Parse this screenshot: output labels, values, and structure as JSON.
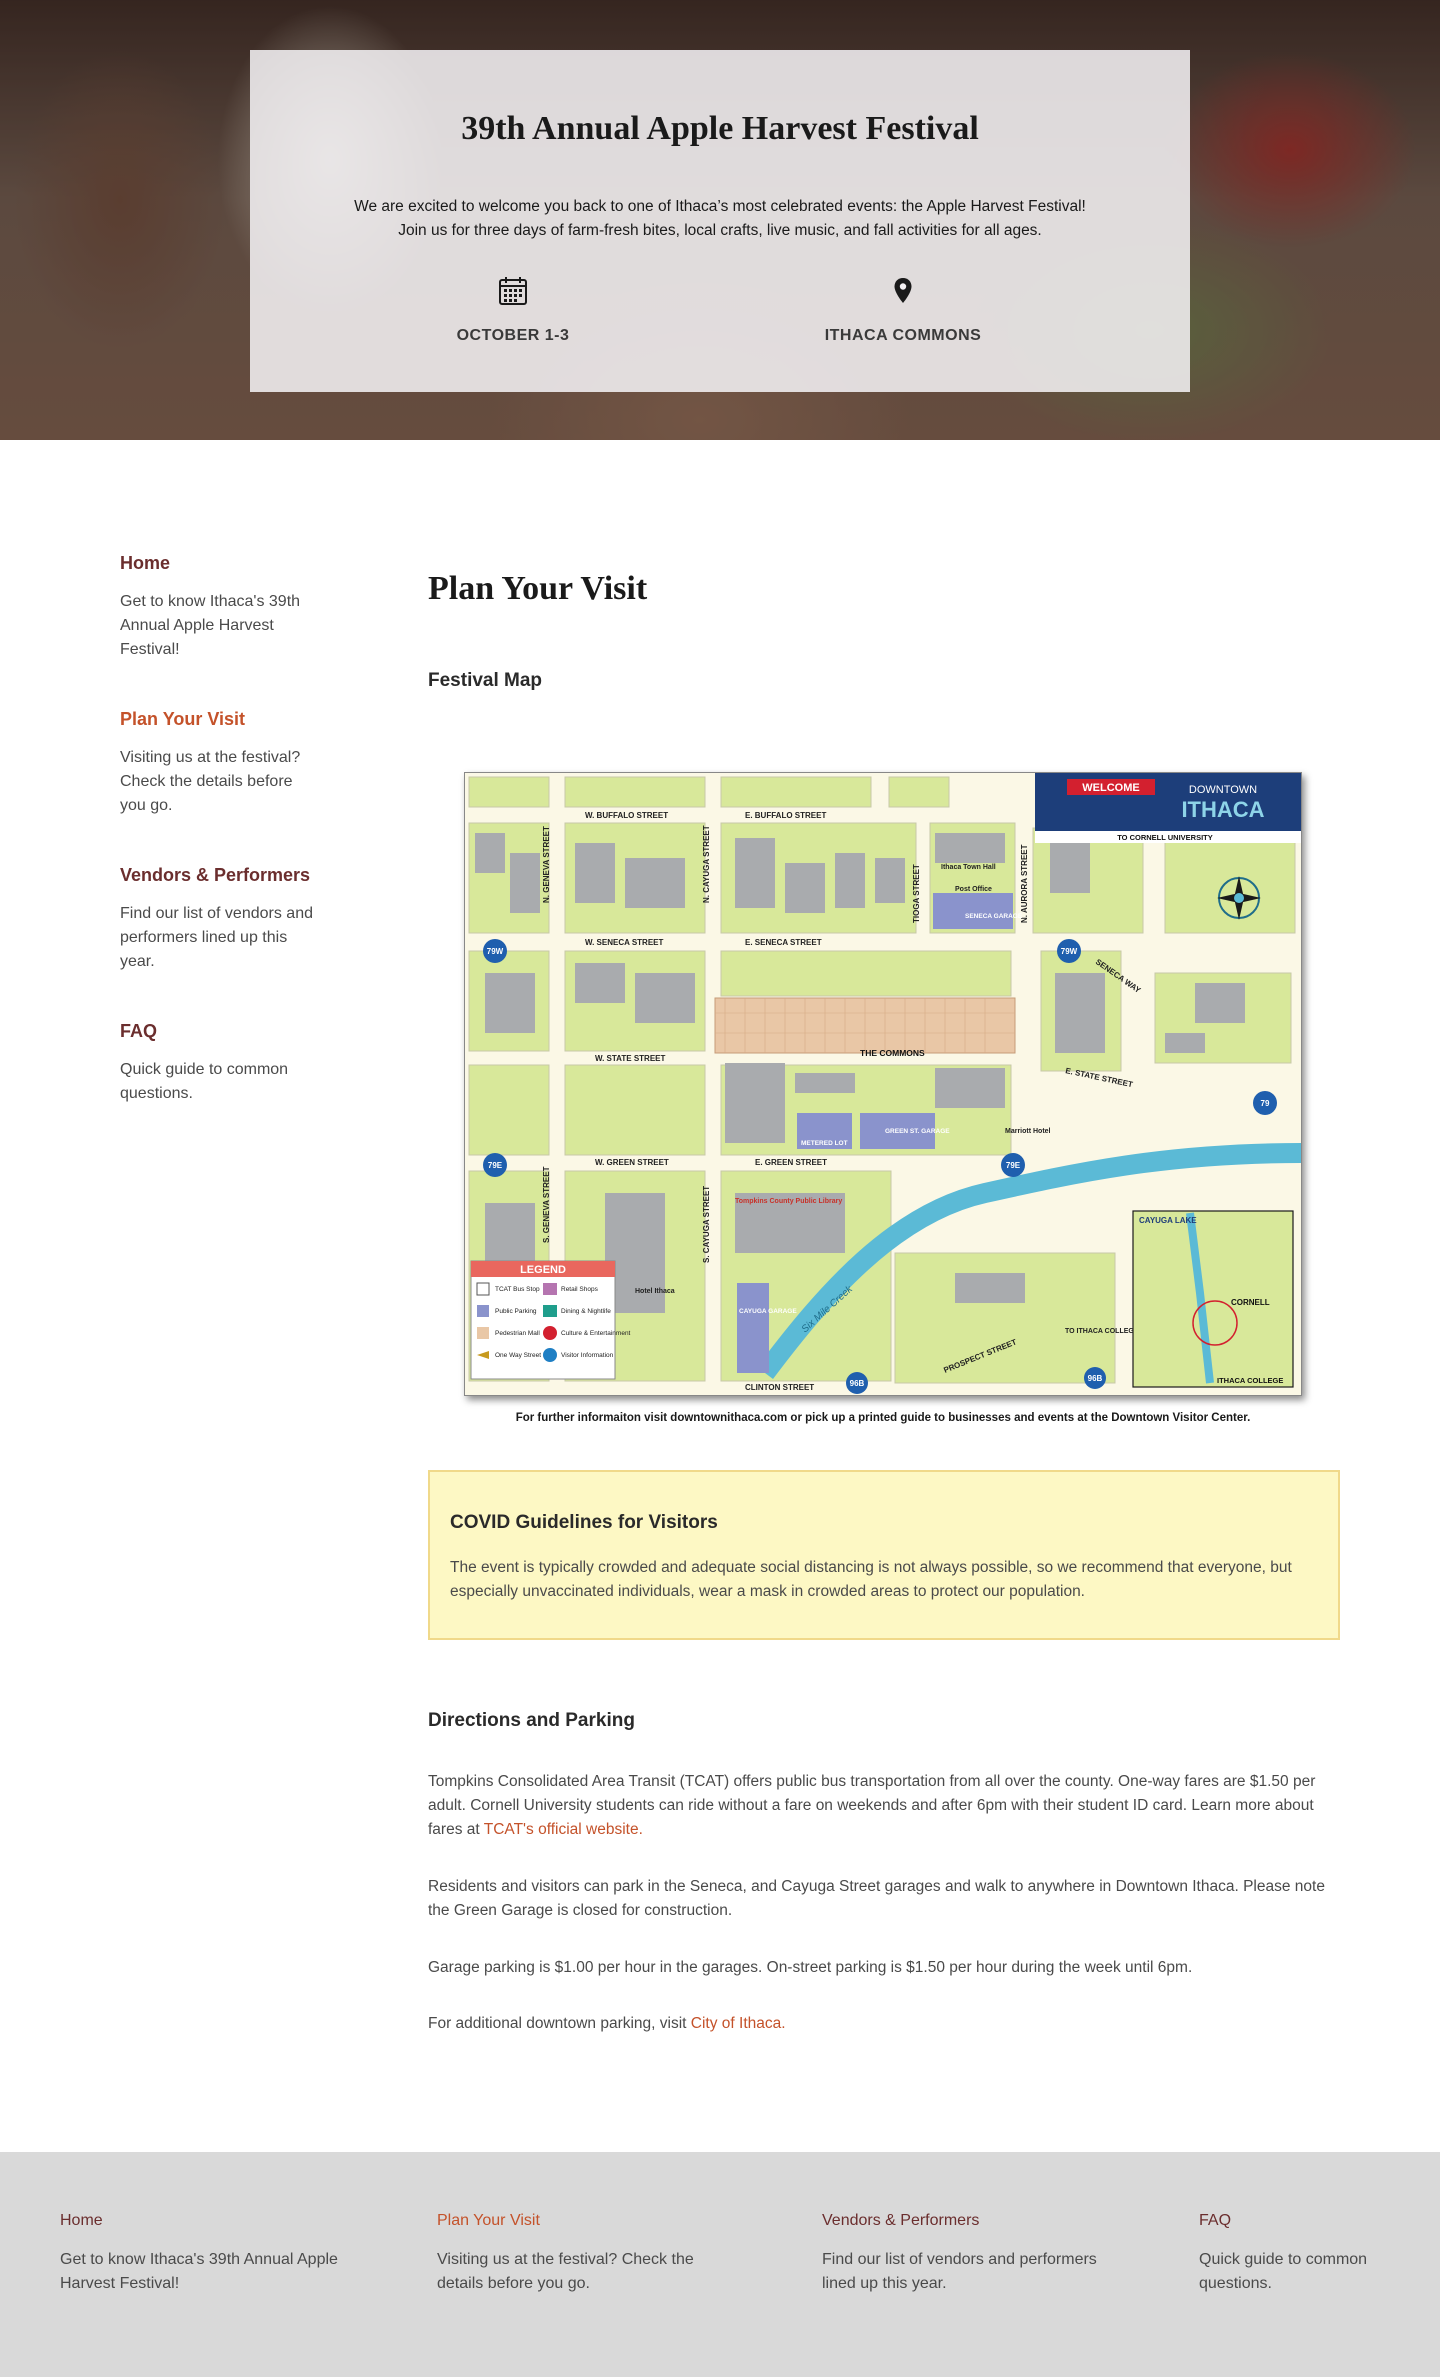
{
  "hero": {
    "title": "39th Annual Apple Harvest Festival",
    "intro": "We are excited to welcome you back to one of Ithaca’s most celebrated events: the Apple Harvest Festival! Join us for three days of farm-fresh bites, local crafts, live music, and fall activities for all ages.",
    "date_icon": "calendar-icon",
    "date_label": "OCTOBER 1-3",
    "location_icon": "map-pin-icon",
    "location_label": "ITHACA COMMONS"
  },
  "sidebar": {
    "items": [
      {
        "label": "Home",
        "desc": "Get to know Ithaca's 39th Annual Apple Harvest Festival!"
      },
      {
        "label": "Plan Your Visit",
        "desc": "Visiting us at the festival? Check the details before you go."
      },
      {
        "label": "Vendors & Performers",
        "desc": "Find our list of vendors and performers lined up this year."
      },
      {
        "label": "FAQ",
        "desc": "Quick guide to common questions."
      }
    ]
  },
  "main": {
    "title": "Plan Your Visit",
    "map_heading": "Festival Map",
    "map": {
      "banner_welcome": "WELCOME",
      "banner_downtown": "DOWNTOWN",
      "banner_ithaca": "ITHACA",
      "to_cornell": "TO CORNELL UNIVERSITY",
      "streets": {
        "w_buffalo": "W. BUFFALO STREET",
        "e_buffalo": "E. BUFFALO STREET",
        "w_seneca": "W. SENECA STREET",
        "e_seneca": "E. SENECA STREET",
        "w_state": "W. STATE STREET",
        "e_state": "E. STATE STREET",
        "w_green": "W. GREEN STREET",
        "e_green": "E. GREEN STREET",
        "clinton": "CLINTON STREET",
        "prospect": "PROSPECT STREET",
        "n_geneva": "N. GENEVA STREET",
        "s_geneva": "S. GENEVA STREET",
        "n_cayuga": "N. CAYUGA STREET",
        "s_cayuga": "S. CAYUGA STREET",
        "tioga": "TIOGA STREET",
        "n_aurora": "N. AURORA STREET",
        "seneca_way": "SENECA WAY",
        "six_mile_creek": "Six Mile Creek"
      },
      "places": {
        "commons": "THE COMMONS",
        "seneca_garage": "SENECA GARAGE",
        "green_garage": "GREEN ST. GARAGE",
        "cayuga_garage": "CAYUGA GARAGE",
        "metered_lot": "METERED LOT",
        "library": "Tompkins County Public Library",
        "city_hall": "Ithaca Town Hall",
        "post_office": "Post Office",
        "hotel_ithaca": "Hotel Ithaca",
        "marriott": "Marriott Hotel",
        "to_ithaca_college": "TO ITHACA COLLEGE",
        "cayuga_lake": "CAYUGA LAKE",
        "cornell": "CORNELL",
        "ithaca_college": "ITHACA COLLEGE"
      },
      "route_badges": [
        "79W",
        "79W",
        "79E",
        "79E",
        "79",
        "96B",
        "96B"
      ],
      "legend_title": "LEGEND",
      "legend_items": [
        "TCAT Bus Stop",
        "Retail Shops",
        "Public Parking",
        "Dining & Nightlife",
        "Pedestrian Mall",
        "Culture & Entertainment",
        "One Way Street",
        "Visitor Information"
      ],
      "colors": {
        "block": "#d8e89a",
        "building": "#a9abae",
        "road": "#fbf8e6",
        "creek": "#5bbad6",
        "garage": "#8a93cc",
        "banner": "#1d3e7a"
      }
    },
    "map_caption": "For further informaiton visit downtownithaca.com or pick up a printed guide to businesses and events at the Downtown Visitor Center.",
    "covid": {
      "title": "COVID Guidelines for Visitors",
      "body": "The event is typically crowded and adequate social distancing is not always possible, so we recommend that everyone, but especially unvaccinated individuals, wear a mask in crowded areas to protect our population."
    },
    "directions": {
      "title": "Directions and Parking",
      "p1": "Tompkins Consolidated Area Transit (TCAT) offers public bus transportation from all over the county. One-way fares are $1.50 per adult. Cornell University students can ride without a fare on weekends and after 6pm with their student ID card. Learn more about fares at",
      "p1_link": "TCAT's official website.",
      "p2": "Residents and visitors can park in the Seneca, and Cayuga Street garages and walk to anywhere in Downtown Ithaca. Please note the Green Garage is closed for construction.",
      "p3": "Garage parking is $1.00 per hour in the garages. On-street parking is $1.50 per hour during the week until 6pm.",
      "p4": "For additional downtown parking, visit",
      "p4_link": "City of Ithaca."
    }
  },
  "footer": {
    "items": [
      {
        "label": "Home",
        "desc": "Get to know Ithaca's 39th Annual Apple Harvest Festival!"
      },
      {
        "label": "Plan Your Visit",
        "desc": "Visiting us at the festival? Check the details before you go."
      },
      {
        "label": "Vendors & Performers",
        "desc": "Find our list of vendors and performers lined up this year."
      },
      {
        "label": "FAQ",
        "desc": "Quick guide to common questions."
      }
    ]
  }
}
